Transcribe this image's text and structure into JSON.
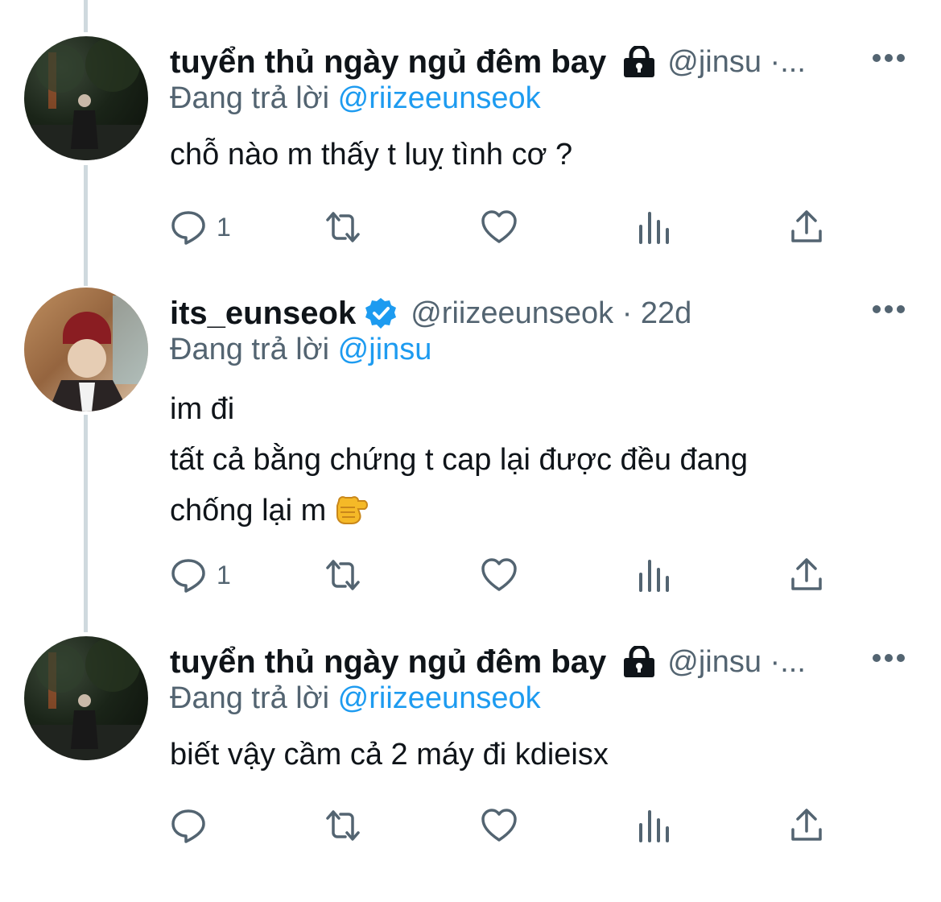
{
  "tweets": [
    {
      "author_name": "tuyển thủ ngày ngủ đêm bay",
      "handle_meta": "@jinsu ·...",
      "badge": "lock-icon",
      "replying_label": "Đang trả lời",
      "replying_to": "@riizeeunseok",
      "lines": [
        "chỗ nào m thấy t luỵ tình cơ ?"
      ],
      "reply_count": "1"
    },
    {
      "author_name": "its_eunseok",
      "handle_meta": "@riizeeunseok · 22d",
      "badge": "verified-icon",
      "replying_label": "Đang trả lời",
      "replying_to": "@jinsu",
      "lines": [
        "im đi",
        "tất cả bằng chứng t cap lại được đều đang",
        "chống lại m"
      ],
      "trailing_emoji": "pointing-fist-emoji",
      "reply_count": "1"
    },
    {
      "author_name": "tuyển thủ ngày ngủ đêm bay",
      "handle_meta": "@jinsu ·...",
      "badge": "lock-icon",
      "replying_label": "Đang trả lời",
      "replying_to": "@riizeeunseok",
      "lines": [
        "biết vậy cầm cả 2 máy đi kdieisx"
      ],
      "reply_count": ""
    }
  ],
  "colors": {
    "text": "#0f1419",
    "secondary": "#536471",
    "accent": "#1d9bf0",
    "thread_line": "#cfd9de"
  },
  "icons": [
    "reply-icon",
    "retweet-icon",
    "like-icon",
    "views-icon",
    "share-icon",
    "more-icon"
  ]
}
